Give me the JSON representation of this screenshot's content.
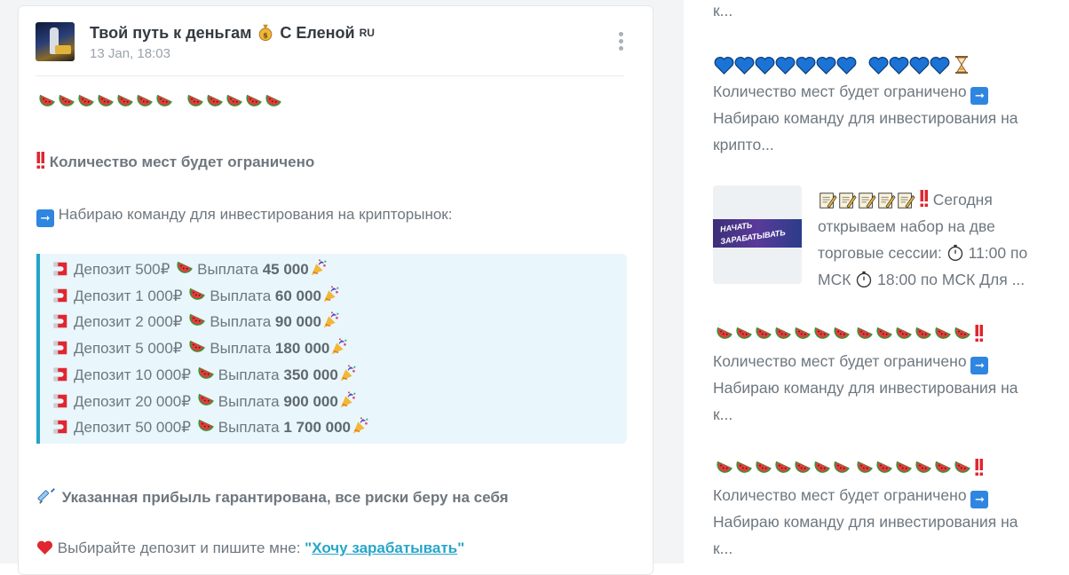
{
  "post": {
    "channel_name": "Твой путь к деньгам",
    "channel_name_suffix": "С Еленой",
    "channel_region": "RU",
    "date": "13 Jan, 18:03",
    "emoji_line": "watermelon x7, watermelon x5",
    "limited_text": "Количество мест будет ограничено",
    "recruit_text": "Набираю команду для инвестирования на крипторынок:",
    "deposits": [
      {
        "deposit": "Депозит 500₽",
        "payout_label": "Выплата",
        "payout": "45 000"
      },
      {
        "deposit": "Депозит 1 000₽",
        "payout_label": "Выплата",
        "payout": "60 000"
      },
      {
        "deposit": "Депозит 2 000₽",
        "payout_label": "Выплата",
        "payout": "90 000"
      },
      {
        "deposit": "Депозит 5 000₽",
        "payout_label": "Выплата",
        "payout": "180 000"
      },
      {
        "deposit": "Депозит 10 000₽",
        "payout_label": "Выплата",
        "payout": "350 000"
      },
      {
        "deposit": "Депозит 20 000₽",
        "payout_label": "Выплата",
        "payout": "900 000"
      },
      {
        "deposit": "Депозит 50 000₽",
        "payout_label": "Выплата",
        "payout": "1 700 000"
      }
    ],
    "guarantee_text": "Указанная прибыль гарантирована, все риски беру на себя",
    "choose_text": "Выбирайте депозит и пишите мне:",
    "cta_quote_open": "\"",
    "cta_link": "Хочу зарабатывать",
    "cta_quote_close": "\""
  },
  "sidebar": {
    "item0_tail": "к...",
    "item1": {
      "line1": "Количество мест будет ограничено",
      "line2": "Набираю команду для инвестирования на",
      "line3": "крипто..."
    },
    "item2": {
      "thumb_text_1": "НАЧАТЬ",
      "thumb_text_2": "ЗАРАБАТЫВАТЬ",
      "line1_tail": "Сегодня",
      "line2": "открываем набор на две",
      "line3_a": "торговые сессии:",
      "line3_b": "11:00 по",
      "line4_a": "МСК",
      "line4_b": "18:00 по МСК Для ..."
    },
    "item3": {
      "line1": "Количество мест будет ограничено",
      "line2": "Набираю команду для инвестирования на",
      "line3": "к..."
    },
    "item4": {
      "line1": "Количество мест будет ограничено",
      "line2": "Набираю команду для инвестирования на",
      "line3": "к..."
    }
  },
  "colors": {
    "accent": "#27a5c8",
    "quote_bg": "#e9f6fb",
    "text": "#6e777f",
    "title": "#333a41"
  }
}
